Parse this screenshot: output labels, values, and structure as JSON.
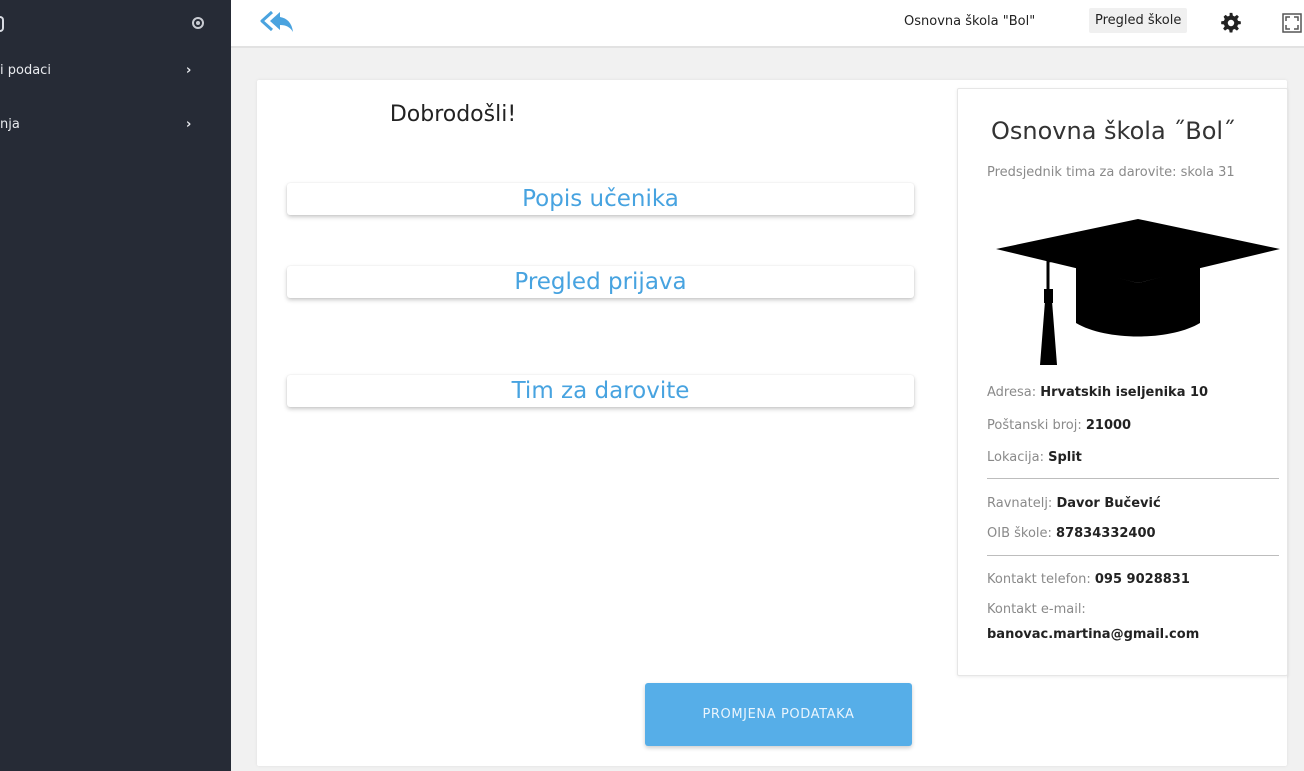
{
  "sidebar": {
    "items": [
      {
        "label": "i podaci"
      },
      {
        "label": "nja"
      }
    ],
    "chevron": "›",
    "colors": {
      "background": "#262b36",
      "text": "#e8eaee"
    }
  },
  "header": {
    "back_icon": "reply-all-icon",
    "school_link": "Osnovna škola \"Bol\"",
    "pregled_link": "Pregled škole",
    "settings_icon": "gear-icon",
    "fullscreen_icon": "expand-icon"
  },
  "main": {
    "welcome": "Dobrodošli!",
    "buttons": [
      {
        "label": "Popis učenika"
      },
      {
        "label": "Pregled prijava"
      },
      {
        "label": "Tim za darovite"
      }
    ],
    "edit_button": "PROMJENA PODATAKA",
    "accent_color": "#47a3e0"
  },
  "school": {
    "name": "Osnovna škola ˝Bol˝",
    "president": "Predsjednik tima za darovite: skola 31",
    "image_icon": "graduation-cap-icon",
    "address_label": "Adresa:",
    "address": "Hrvatskih iseljenika 10",
    "postal_label": "Poštanski broj:",
    "postal": "21000",
    "location_label": "Lokacija:",
    "location": "Split",
    "principal_label": "Ravnatelj:",
    "principal": "Davor Bučević",
    "oib_label": "OIB škole:",
    "oib": "87834332400",
    "phone_label": "Kontakt telefon:",
    "phone": "095 9028831",
    "email_label": "Kontakt e-mail:",
    "email": "banovac.martina@gmail.com"
  }
}
